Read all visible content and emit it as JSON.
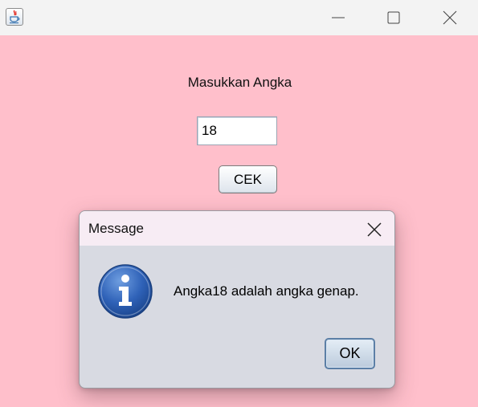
{
  "window": {
    "app_icon": "java-icon",
    "controls": {
      "minimize_icon": "minimize-icon",
      "maximize_icon": "maximize-icon",
      "close_icon": "close-icon"
    },
    "background_color": "#ffbfcb"
  },
  "form": {
    "prompt_label": "Masukkan Angka",
    "number_value": "18",
    "check_button_label": "CEK"
  },
  "dialog": {
    "title": "Message",
    "close_icon": "close-icon",
    "icon": "info-icon",
    "message": "Angka18 adalah angka genap.",
    "ok_label": "OK"
  }
}
